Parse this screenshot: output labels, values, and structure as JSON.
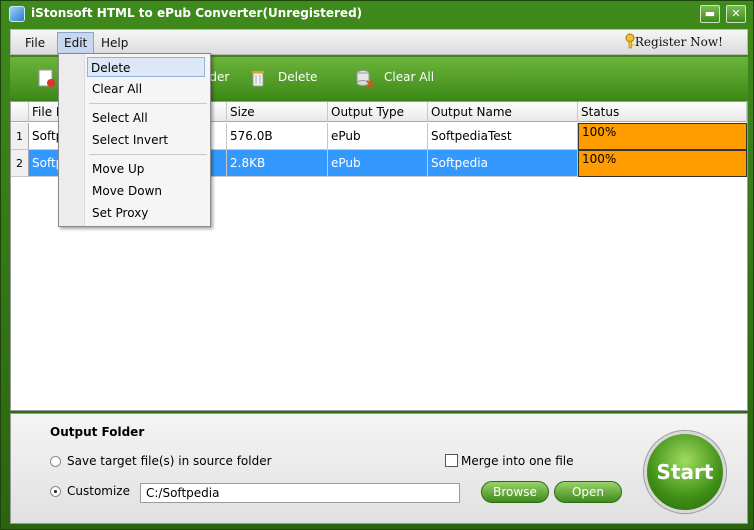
{
  "window": {
    "title": "iStonsoft HTML to ePub Converter(Unregistered)",
    "minimize_label": "▬",
    "close_label": "✕"
  },
  "menubar": {
    "file": "File",
    "edit": "Edit",
    "help": "Help",
    "register": "Register  Now!"
  },
  "toolbar": {
    "add_folder_partial": "lder",
    "delete": "Delete",
    "clear_all": "Clear All"
  },
  "table": {
    "headers": {
      "file_name": "File N",
      "size": "Size",
      "output_type": "Output Type",
      "output_name": "Output Name",
      "status": "Status"
    },
    "rows": [
      {
        "num": "1",
        "file_name": "Softp",
        "size": "576.0B",
        "output_type": "ePub",
        "output_name": "SoftpediaTest",
        "status": "100%"
      },
      {
        "num": "2",
        "file_name": "Softp",
        "size": "2.8KB",
        "output_type": "ePub",
        "output_name": "Softpedia",
        "status": "100%"
      }
    ]
  },
  "context_menu": {
    "items": [
      "Delete",
      "Clear All",
      "Select All",
      "Select Invert",
      "Move Up",
      "Move Down",
      "Set Proxy"
    ]
  },
  "output": {
    "heading": "Output Folder",
    "source_label": "Save target file(s) in source folder",
    "customize_label": "Customize",
    "path_value": "C:/Softpedia",
    "merge_label": "Merge into one file",
    "browse": "Browse",
    "open": "Open",
    "start": "Start"
  },
  "colors": {
    "green_dark": "#2a6410",
    "green_light": "#6cb53b",
    "selection": "#3399ff",
    "status_fill": "#ff9c00"
  }
}
